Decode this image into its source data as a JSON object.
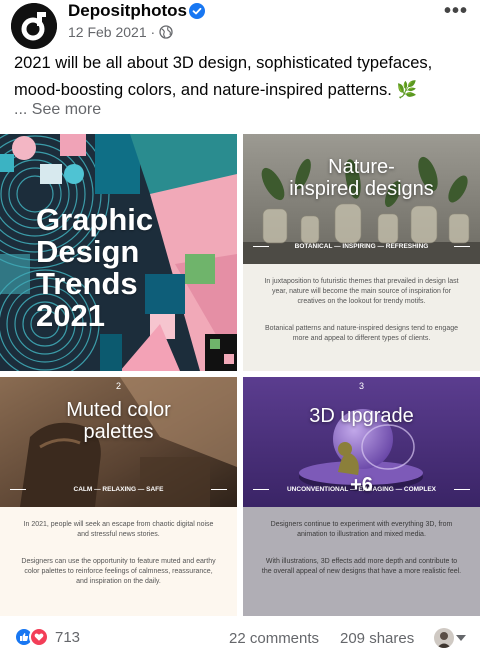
{
  "post": {
    "author": "Depositphotos",
    "date": "12 Feb 2021 ·",
    "text": "2021 will be all about 3D design, sophisticated typefaces, mood-boosting colors, and nature-inspired patterns. 🌿",
    "see_more": "... See more",
    "more_label": "•••"
  },
  "tiles": {
    "t1": {
      "title_lines": [
        "Graphic",
        "Design",
        "Trends",
        "2021"
      ]
    },
    "t2": {
      "heading_lines": [
        "Nature-",
        "inspired designs"
      ],
      "tagline": "BOTANICAL — INSPIRING — REFRESHING",
      "body1": "In juxtaposition to futuristic themes that prevailed in design last year, nature will become the main source of inspiration for creatives on the lookout for trendy motifs.",
      "body2": "Botanical patterns and nature-inspired designs tend to engage more and appeal to different types of clients."
    },
    "t3": {
      "number": "2",
      "heading_lines": [
        "Muted color",
        "palettes"
      ],
      "tagline": "CALM — RELAXING — SAFE",
      "body1": "In 2021, people will seek an escape from chaotic digital noise and stressful news stories.",
      "body2": "Designers can use the opportunity to feature muted and earthy color palettes to reinforce feelings of calmness, reassurance, and inspiration on the daily."
    },
    "t4": {
      "number": "3",
      "heading": "3D upgrade",
      "tagline": "UNCONVENTIONAL — ENGAGING — COMPLEX",
      "overlay": "+6",
      "body1": "Designers continue to experiment with everything 3D, from animation to illustration and mixed media.",
      "body2": "With illustrations, 3D effects add more depth and contribute to the overall appeal of new designs that have a more realistic feel."
    }
  },
  "footer": {
    "reaction_count": "713",
    "comments": "22 comments",
    "shares": "209 shares"
  },
  "colors": {
    "facebook_blue": "#1877f2",
    "love_red": "#f33e58",
    "meta_gray": "#65676b"
  }
}
